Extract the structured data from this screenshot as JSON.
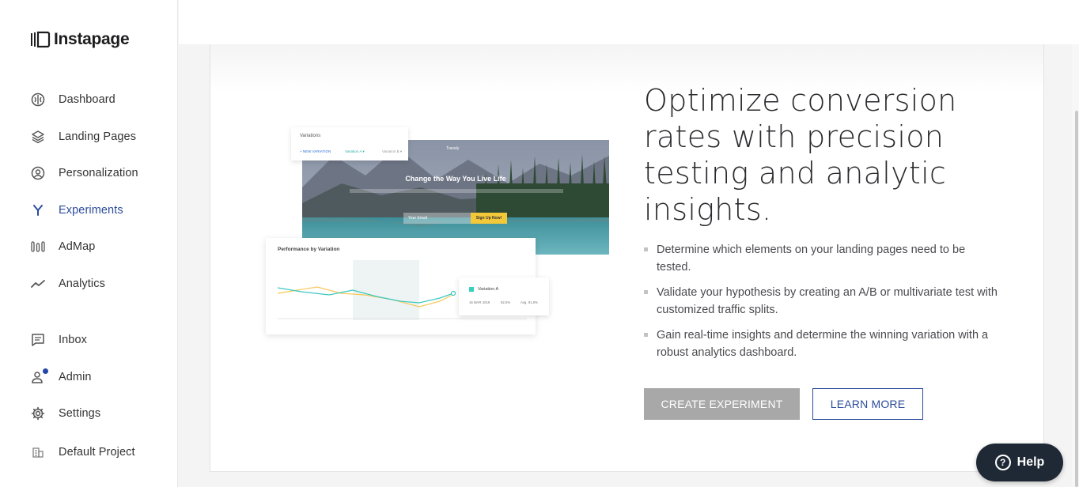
{
  "brand": {
    "name": "Instapage"
  },
  "sidebar": {
    "items": [
      {
        "label": "Dashboard",
        "icon": "dashboard-icon"
      },
      {
        "label": "Landing Pages",
        "icon": "layers-icon"
      },
      {
        "label": "Personalization",
        "icon": "person-circle-icon"
      },
      {
        "label": "Experiments",
        "icon": "branch-icon",
        "active": true
      },
      {
        "label": "AdMap",
        "icon": "admap-icon"
      },
      {
        "label": "Analytics",
        "icon": "trend-line-icon"
      },
      {
        "label": "Inbox",
        "icon": "inbox-icon"
      },
      {
        "label": "Admin",
        "icon": "user-icon",
        "badge": true
      },
      {
        "label": "Settings",
        "icon": "gear-icon"
      },
      {
        "label": "Default Project",
        "icon": "building-icon"
      }
    ]
  },
  "main": {
    "headline": "Optimize conversion rates with precision testing and analytic insights.",
    "bullets": [
      "Determine which elements on your landing pages need to be tested.",
      "Validate your hypothesis by creating an A/B or multivariate test with customized traffic splits.",
      "Gain real-time insights and determine the winning variation with a robust analytics dashboard."
    ],
    "primary_button": "CREATE EXPERIMENT",
    "secondary_button": "LEARN MORE"
  },
  "illustration": {
    "variations_title": "Variations",
    "new_variation": "+ NEW VARIATION",
    "variation_a": "Variation A ▾",
    "variation_b": "Variation B ▾",
    "hero_brand": "Travely",
    "hero_title": "Change the Way You Live Life",
    "hero_input": "Your Email",
    "hero_button": "Sign Up Now!",
    "perf_title": "Performance by Variation",
    "tooltip_title": "Variation A",
    "tooltip_date": "16 MAR 2019",
    "tooltip_pct1": "82.5%",
    "tooltip_pct2": "Avg. 91.8%"
  },
  "help": {
    "label": "Help"
  },
  "colors": {
    "accent": "#2b4b9b",
    "primary_button_bg": "#a8a8a8",
    "help_bg": "#1f2935",
    "badge": "#2446a8"
  }
}
